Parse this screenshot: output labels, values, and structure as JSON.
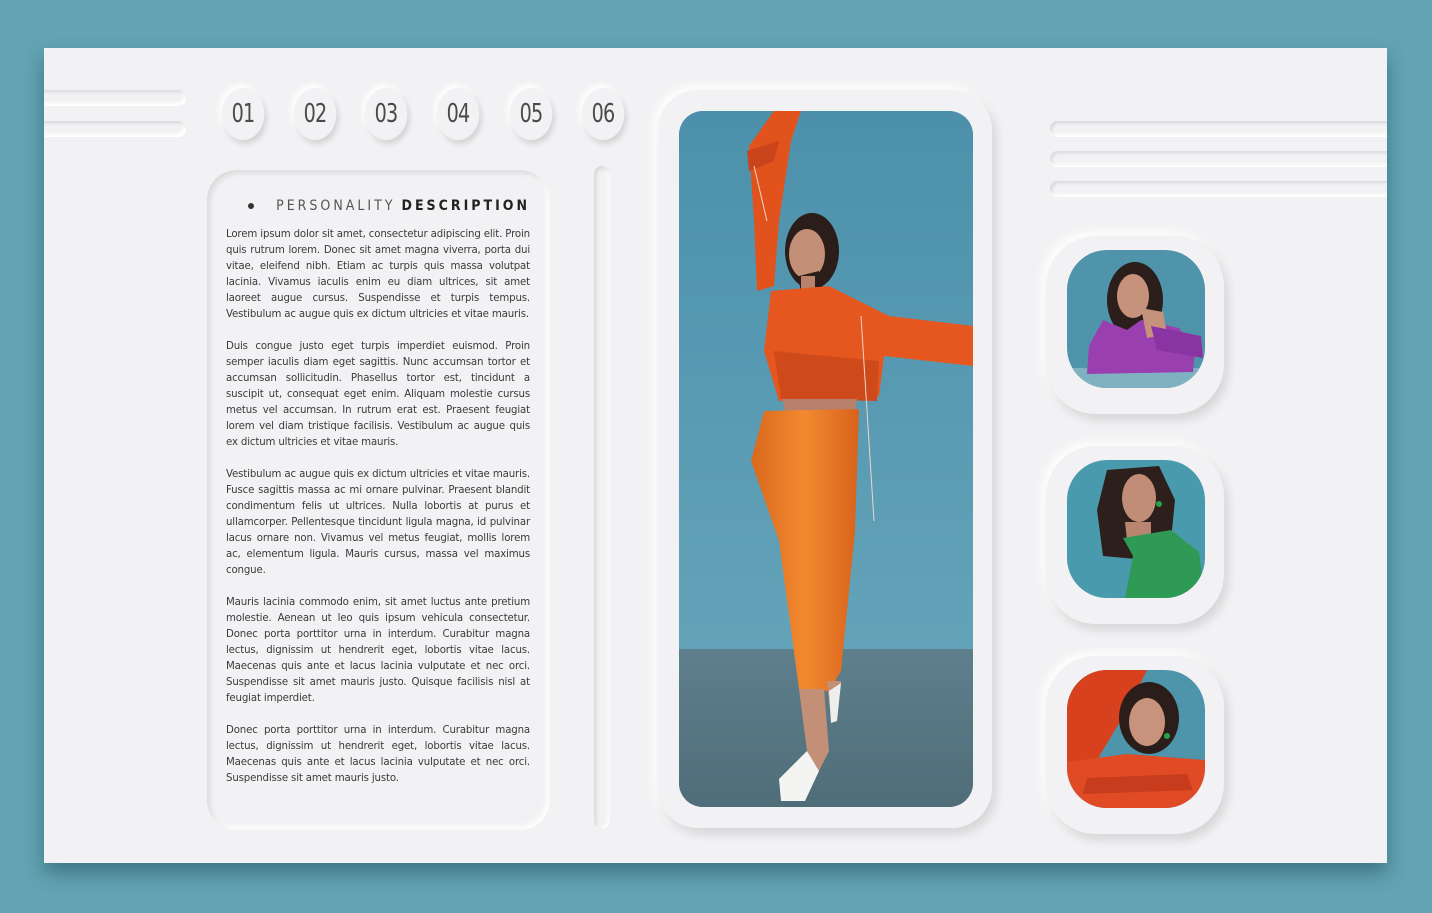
{
  "tabs": [
    {
      "label": "01"
    },
    {
      "label": "02"
    },
    {
      "label": "03"
    },
    {
      "label": "04"
    },
    {
      "label": "05"
    },
    {
      "label": "06"
    }
  ],
  "description": {
    "heading_light": "PERSONALITY",
    "heading_bold": "DESCRIPTION",
    "paragraphs": [
      "Lorem ipsum dolor sit amet, consectetur adipiscing elit. Proin quis rutrum lorem. Donec sit amet magna viverra, porta dui vitae, eleifend nibh. Etiam ac turpis quis massa volutpat lacinia. Vivamus iaculis enim eu diam ultrices, sit amet laoreet augue cursus. Suspendisse et turpis tempus. Vestibulum ac augue quis ex dictum ultricies et vitae mauris.",
      "Duis congue justo eget turpis imperdiet euismod. Proin semper iaculis diam eget sagittis. Nunc accumsan tortor et accumsan sollicitudin. Phasellus tortor est, tincidunt a suscipit ut, consequat eget enim. Aliquam molestie cursus metus vel accumsan. In rutrum erat est. Praesent feugiat lorem vel diam tristique facilisis. Vestibulum ac augue quis ex dictum ultricies et vitae mauris.",
      "Vestibulum ac augue quis ex dictum ultricies et vitae mauris. Fusce sagittis massa ac mi ornare pulvinar. Praesent blandit condimentum felis ut ultrices. Nulla lobortis at purus et ullamcorper. Pellentesque tincidunt ligula magna, id pulvinar lacus ornare non. Vivamus vel metus feugiat, mollis lorem ac, elementum ligula. Mauris cursus, massa vel maximus congue.",
      "Mauris lacinia commodo enim, sit amet luctus ante pretium molestie. Aenean ut leo quis ipsum vehicula consectetur. Donec porta porttitor urna in interdum. Curabitur magna lectus, dignissim ut hendrerit eget, lobortis vitae lacus. Maecenas quis ante et lacus lacinia vulputate et nec orci. Suspendisse sit amet mauris justo. Quisque facilisis nisl at feugiat imperdiet.",
      "Donec porta porttitor urna in interdum. Curabitur magna lectus, dignissim ut hendrerit eget, lobortis vitae lacus. Maecenas quis ante et lacus lacinia vulputate et nec orci. Suspendisse sit amet mauris justo."
    ]
  },
  "colors": {
    "page_background": "#62a4b3",
    "card_background": "#f2f2f4",
    "photo_wall": "#4f93ad",
    "outfit_orange": "#e8591f",
    "thumb_purple": "#9a3fb0",
    "thumb_green": "#2f9a55",
    "thumb_red": "#e04a24"
  }
}
